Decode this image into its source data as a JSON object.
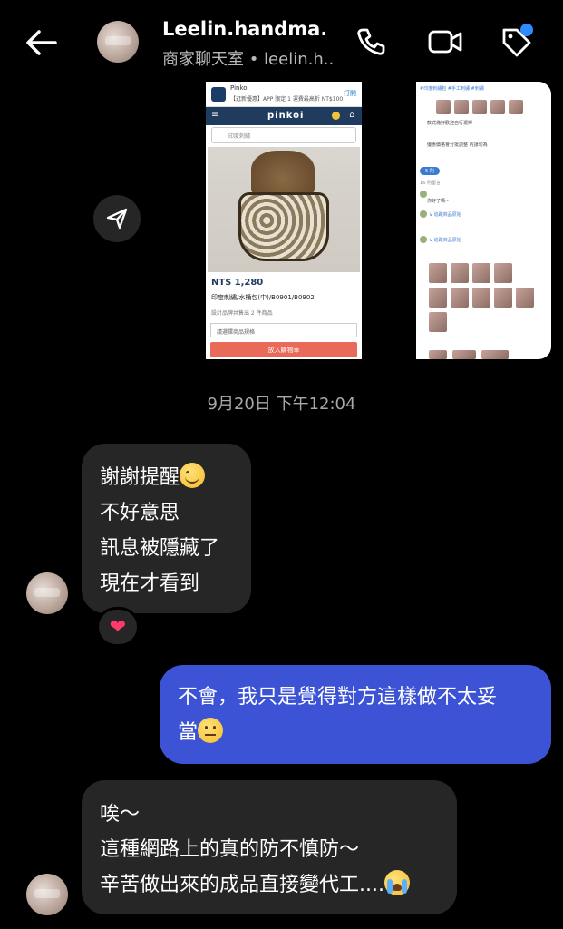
{
  "header": {
    "name": "Leelin.handma...",
    "subtitle": "商家聊天室 • leelin.h..."
  },
  "shared_screenshot_1": {
    "app_name": "Pinkoi",
    "promo": "【逛新優惠】APP 限定 1 運費最高折 NT$100",
    "open": "打開",
    "brand": "pinkoi",
    "search_placeholder": "印度刺繡",
    "price": "NT$ 1,280",
    "product_name": "印度刺繡/水桶包(中)/B0901/B0902",
    "meta": "設計品牌共售出 2 件商品",
    "select_placeholder": "請選擇商品規格",
    "add_to_cart": "放入購物車"
  },
  "shared_screenshot_2": {
    "pill": "5 則",
    "rows": [
      "#印度刺繡包 #手工刺繡 #刺繡",
      "款式備好歡迎自行選擇",
      "優惠價格會分批調整 內請勿為",
      "16 則留言",
      "你好了嗎~",
      "↳ 追蹤商品原始",
      "↳ 追蹤商品原始"
    ]
  },
  "timestamp": "9月20日 下午12:04",
  "messages": {
    "m1": {
      "line1": "謝謝提醒",
      "line2": "不好意思",
      "line3": "訊息被隱藏了",
      "line4": "現在才看到"
    },
    "m1_reaction": "❤",
    "m2": {
      "line1": "不會，我只是覺得對方這樣做不太妥",
      "line2": "當"
    },
    "m3": {
      "line1": "唉～",
      "line2": "這種網路上的真的防不慎防～",
      "line3": "辛苦做出來的成品直接變代工...."
    }
  },
  "colors": {
    "background": "#000000",
    "received_bubble": "#262626",
    "sent_bubble": "#3c53d6",
    "notification_dot": "#2f8cff"
  },
  "icons": {
    "back": "back-arrow-icon",
    "call": "phone-icon",
    "video": "video-camera-icon",
    "tag": "tag-icon",
    "share": "send-icon"
  }
}
